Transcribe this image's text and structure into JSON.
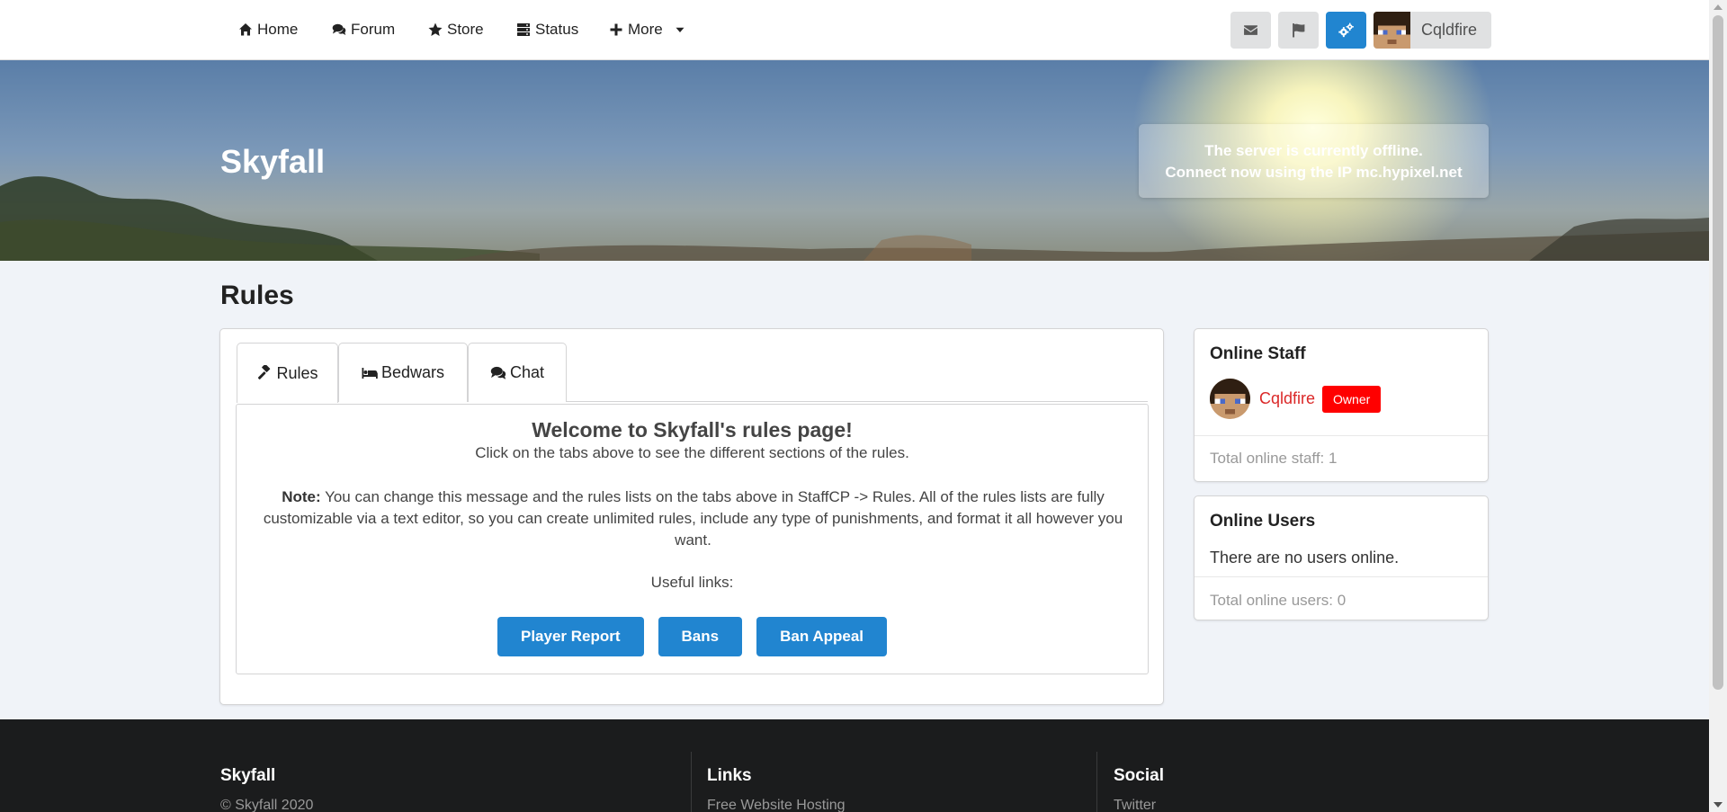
{
  "nav": {
    "items": [
      {
        "label": "Home",
        "icon": "home-icon"
      },
      {
        "label": "Forum",
        "icon": "comments-icon"
      },
      {
        "label": "Store",
        "icon": "star-icon"
      },
      {
        "label": "Status",
        "icon": "server-icon"
      },
      {
        "label": "More",
        "icon": "plus-icon"
      }
    ],
    "username": "Cqldfire"
  },
  "banner": {
    "site_title": "Skyfall",
    "server_line1": "The server is currently offline.",
    "server_line2": "Connect now using the IP mc.hypixel.net"
  },
  "page": {
    "title": "Rules"
  },
  "tabs": [
    {
      "label": "Rules",
      "icon": "gavel-icon"
    },
    {
      "label": "Bedwars",
      "icon": "bed-icon"
    },
    {
      "label": "Chat",
      "icon": "comments-icon"
    }
  ],
  "content": {
    "welcome": "Welcome to Skyfall's rules page!",
    "subline": "Click on the tabs above to see the different sections of the rules.",
    "note_label": "Note:",
    "note_text": " You can change this message and the rules lists on the tabs above in StaffCP -> Rules. All of the rules lists are fully customizable via a text editor, so you can create unlimited rules, include any type of punishments, and format it all however you want.",
    "useful": "Useful links:",
    "buttons": [
      "Player Report",
      "Bans",
      "Ban Appeal"
    ]
  },
  "online_staff": {
    "title": "Online Staff",
    "member": "Cqldfire",
    "badge": "Owner",
    "total": "Total online staff: 1"
  },
  "online_users": {
    "title": "Online Users",
    "empty": "There are no users online.",
    "total": "Total online users: 0"
  },
  "footer": {
    "col1_title": "Skyfall",
    "col1_text": "© Skyfall 2020",
    "col2_title": "Links",
    "col2_text": "Free Website Hosting",
    "col3_title": "Social",
    "col3_text": "Twitter"
  },
  "colors": {
    "accent": "#2185d0",
    "owner_badge": "#ff0000",
    "staff_name": "#db2828",
    "footer_bg": "#1b1c1d"
  }
}
